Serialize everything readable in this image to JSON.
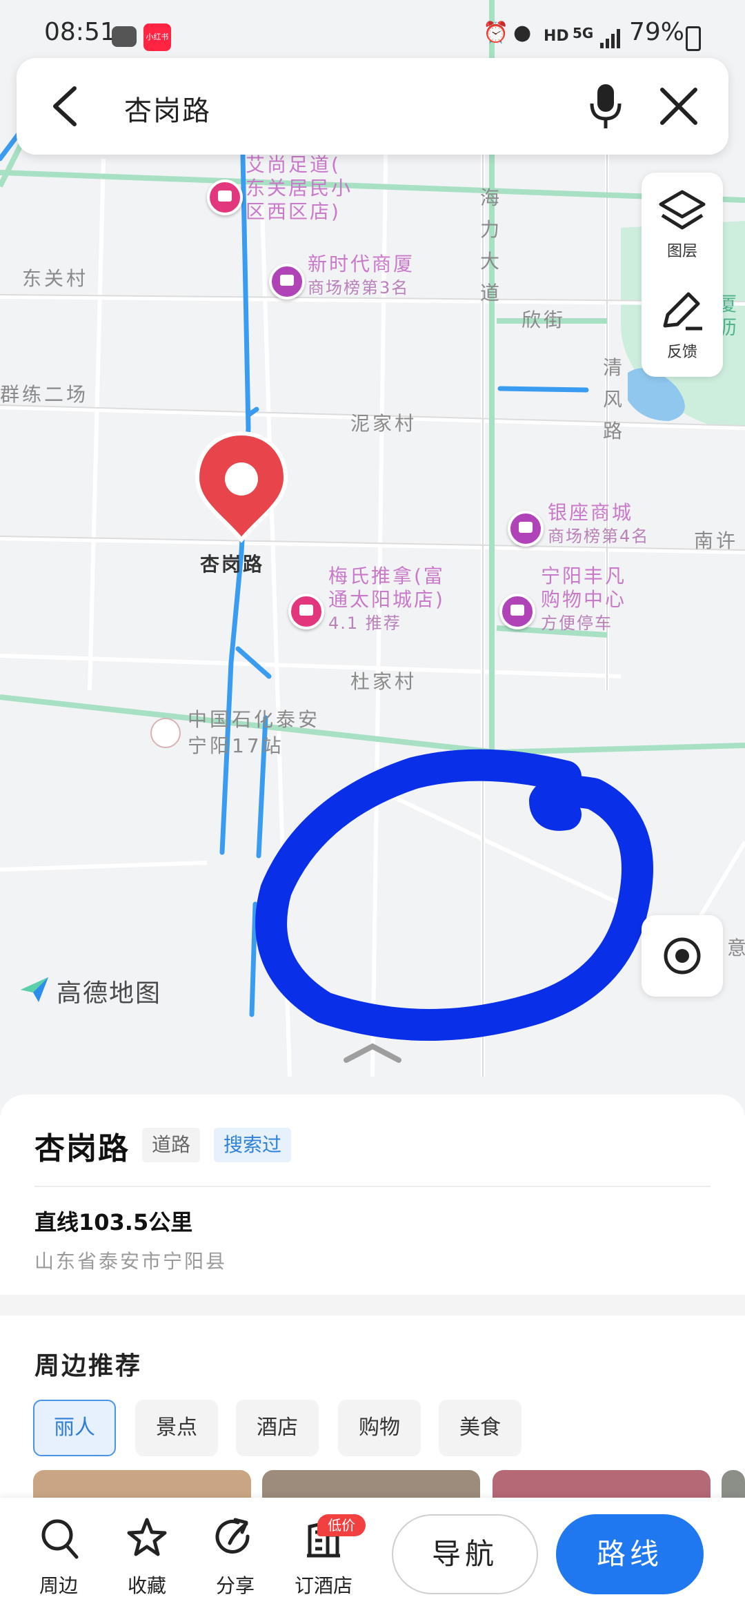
{
  "status_bar": {
    "time": "08:51",
    "app_badge": "小红书",
    "network_hd": "HD",
    "network_5g": "5G",
    "battery": "79%"
  },
  "search": {
    "query": "杏岗路",
    "icons": [
      "back-arrow-icon",
      "microphone-icon",
      "close-icon"
    ]
  },
  "right_panel": {
    "layers_label": "图层",
    "feedback_label": "反馈"
  },
  "map": {
    "places": {
      "dongguan_village": "东关村",
      "drill_field": "群练二场",
      "nijia_village": "泥家村",
      "dujia_village": "杜家村",
      "xin_street": "欣街",
      "nanxu": "南许",
      "yi": "意",
      "haili_avenue": "海力大道",
      "qingfeng_road": "清风路"
    },
    "pois": {
      "aishang_foot": [
        "艾尚足道(",
        "东关居民小",
        "区西区店)"
      ],
      "xinshidai": {
        "name": "新时代商厦",
        "sub": "商场榜第3名"
      },
      "yinzuo": {
        "name": "银座商城",
        "sub": "商场榜第4名"
      },
      "meishi": [
        "梅氏推拿(富",
        "通太阳城店)"
      ],
      "meishi_sub": "4.1 推荐",
      "fengfan": [
        "宁阳丰凡",
        "购物中心"
      ],
      "fengfan_sub": "方便停车",
      "sinopec": [
        "中国石化泰安",
        "宁阳17站"
      ],
      "park_text": [
        "厦",
        "沥"
      ]
    },
    "marker_label": "杏岗路",
    "brand": "高德地图"
  },
  "sheet": {
    "title": "杏岗路",
    "tag_road": "道路",
    "tag_searched": "搜索过",
    "distance": "直线103.5公里",
    "address": "山东省泰安市宁阳县",
    "nearby_title": "周边推荐",
    "chips": [
      "丽人",
      "景点",
      "酒店",
      "购物",
      "美食"
    ],
    "active_chip": "丽人"
  },
  "bottom_bar": {
    "nearby": "周边",
    "favorites": "收藏",
    "share": "分享",
    "hotel": "订酒店",
    "hotel_badge": "低价",
    "navigate": "导航",
    "route": "路线"
  },
  "colors": {
    "route_blue": "#3a9cf0",
    "annotation_blue": "#0a2fe8",
    "primary": "#1f78f0",
    "marker_red": "#e8444c",
    "road_green": "#a8e0c4"
  }
}
